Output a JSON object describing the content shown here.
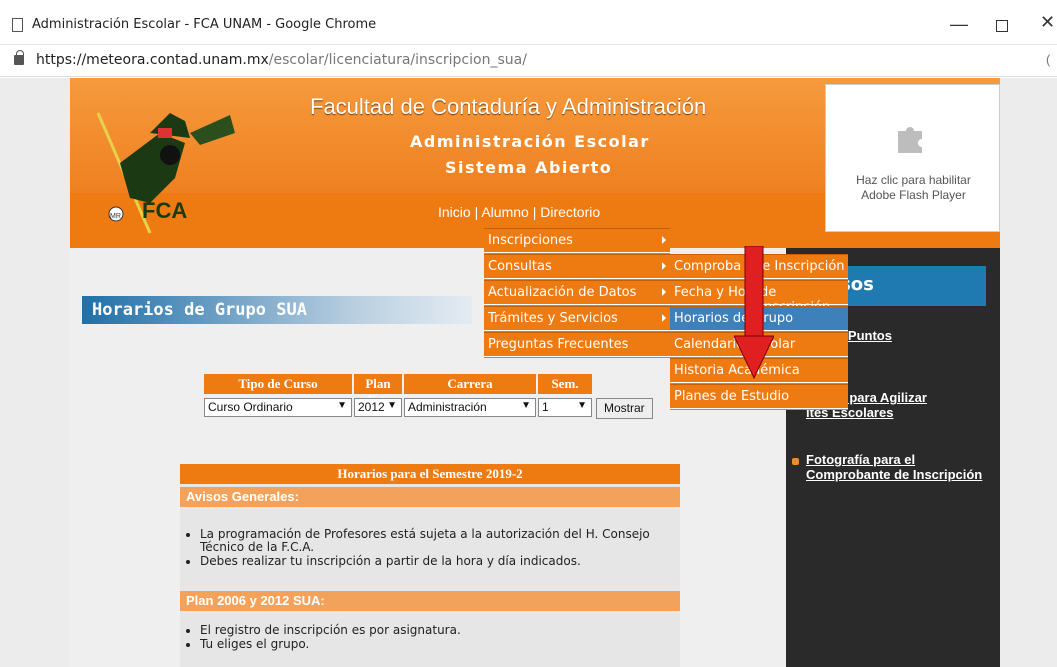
{
  "window": {
    "title": "Administración Escolar - FCA UNAM - Google Chrome",
    "url_host": "https://meteora.contad.unam.mx",
    "url_path": "/escolar/licenciatura/inscripcion_sua/",
    "icons": [
      "document-icon",
      "minimize-icon",
      "maximize-icon",
      "close-icon",
      "lock-icon"
    ]
  },
  "header": {
    "title": "Facultad de Contaduría y Administración",
    "subtitle1": "Administración Escolar",
    "subtitle2": "Sistema Abierto",
    "logo_text": "FCA",
    "nav": [
      "Inicio",
      "Alumno",
      "Directorio"
    ],
    "separator": "|"
  },
  "flash": {
    "line1": "Haz clic para habilitar",
    "line2": "Adobe Flash Player"
  },
  "page_title": "Horarios de Grupo SUA",
  "filter": {
    "headers": [
      "Tipo de Curso",
      "Plan Est.",
      "Carrera",
      "Sem."
    ],
    "values": [
      "Curso Ordinario",
      "2012",
      "Administración",
      "1"
    ],
    "button": "Mostrar"
  },
  "horarios": {
    "title": "Horarios para el Semestre 2019-2",
    "sec1": "Avisos Generales:",
    "sec1_items": [
      "La programación de Profesores está sujeta a la autorización del H. Consejo",
      "Técnico de la F.C.A.",
      "Debes realizar tu inscripción a partir de la hora y día indicados."
    ],
    "sec2": "Plan 2006 y 2012 SUA:",
    "sec2_items": [
      "El registro de inscripción es por asignatura.",
      "Tu eliges el grupo."
    ]
  },
  "menu1": [
    "Inscripciones",
    "Consultas",
    "Actualización de Datos",
    "Trámites y Servicios",
    "Preguntas Frecuentes"
  ],
  "menu2": [
    "Comprobante de Inscripción",
    "Fecha y Hora de Inscripción",
    "Horarios de Grupo",
    "Calendario Escolar",
    "Historia Académica",
    "Planes de Estudio"
  ],
  "menu2_visible": [
    "Comproba",
    "de Inscripción",
    "Fecha y Ho",
    "de Inscripción"
  ],
  "right": {
    "head": "sos",
    "links": [
      [
        "lta tus Puntos",
        "ulares"
      ],
      [
        "onario para Agilizar",
        "ites Escolares"
      ],
      [
        "Fotografía para el",
        "Comprobante de Inscripción"
      ]
    ]
  },
  "colors": {
    "orange": "#ee7a12",
    "blue": "#3e80b9",
    "red_arrow": "#e02020"
  }
}
